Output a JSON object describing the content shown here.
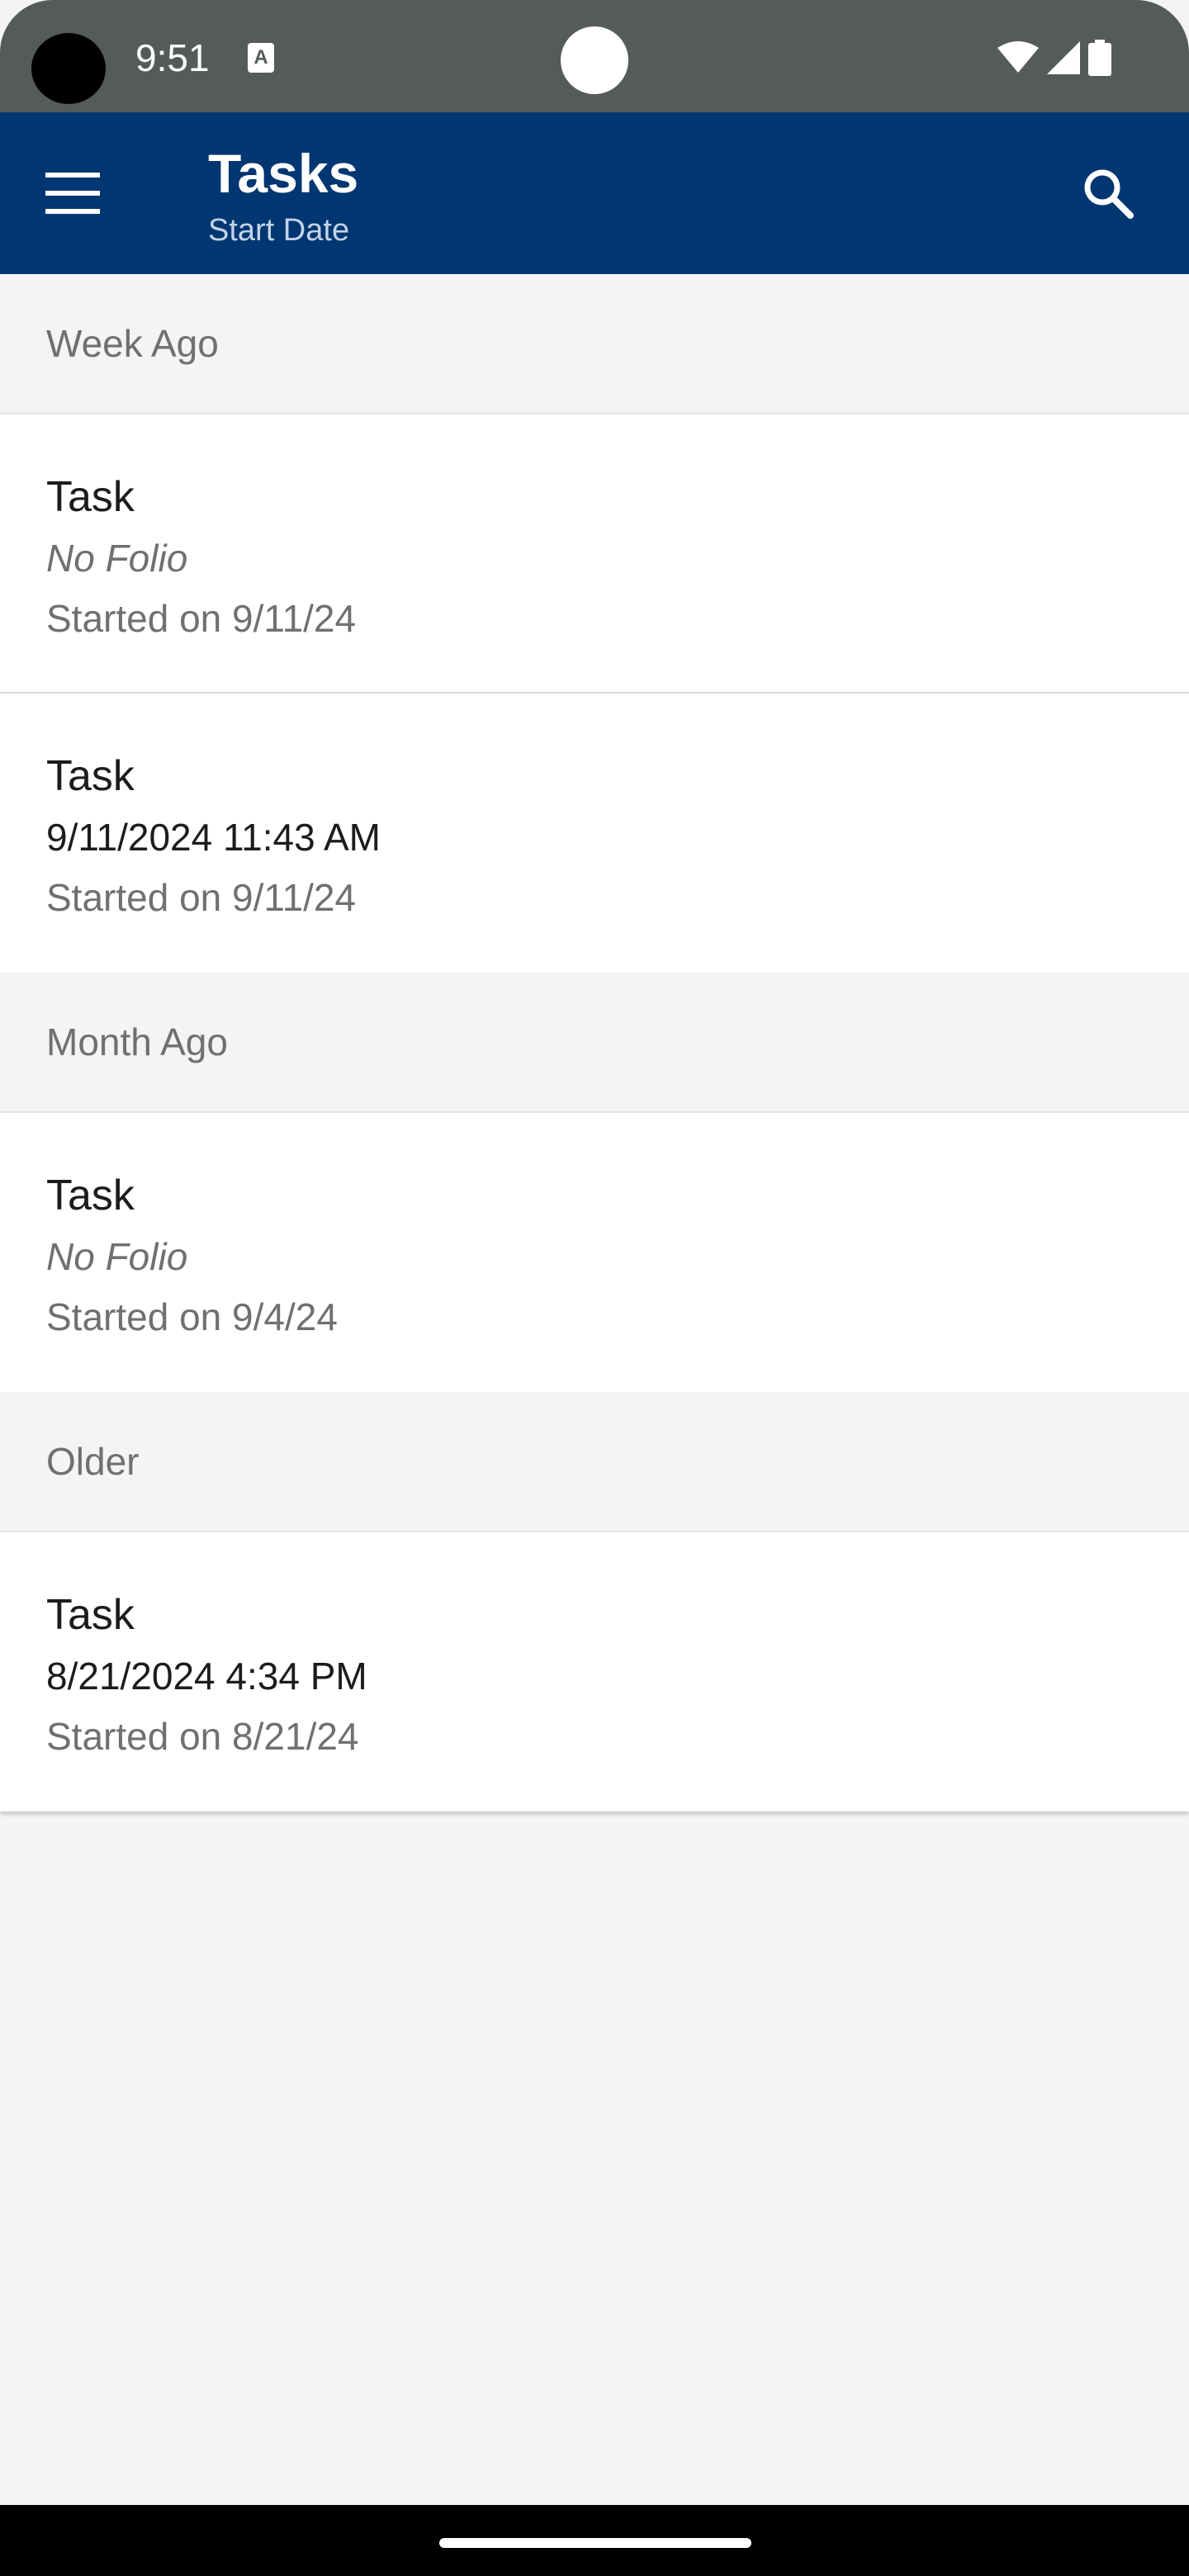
{
  "status_bar": {
    "time": "9:51",
    "notification_icon": "A"
  },
  "app_bar": {
    "title": "Tasks",
    "subtitle": "Start Date"
  },
  "sections": [
    {
      "header": "Week Ago",
      "tasks": [
        {
          "title": "Task",
          "folio": "No Folio",
          "started": "Started on 9/11/24"
        },
        {
          "title": "Task",
          "folio": "9/11/2024 11:43 AM",
          "started": "Started on 9/11/24"
        }
      ]
    },
    {
      "header": "Month Ago",
      "tasks": [
        {
          "title": "Task",
          "folio": "No Folio",
          "started": "Started on 9/4/24"
        }
      ]
    },
    {
      "header": "Older",
      "tasks": [
        {
          "title": "Task",
          "folio": "8/21/2024 4:34 PM",
          "started": "Started on 8/21/24"
        }
      ]
    }
  ],
  "colors": {
    "app_bar": "#003672",
    "status_bar": "#555b5a",
    "background": "#f4f3f5"
  }
}
